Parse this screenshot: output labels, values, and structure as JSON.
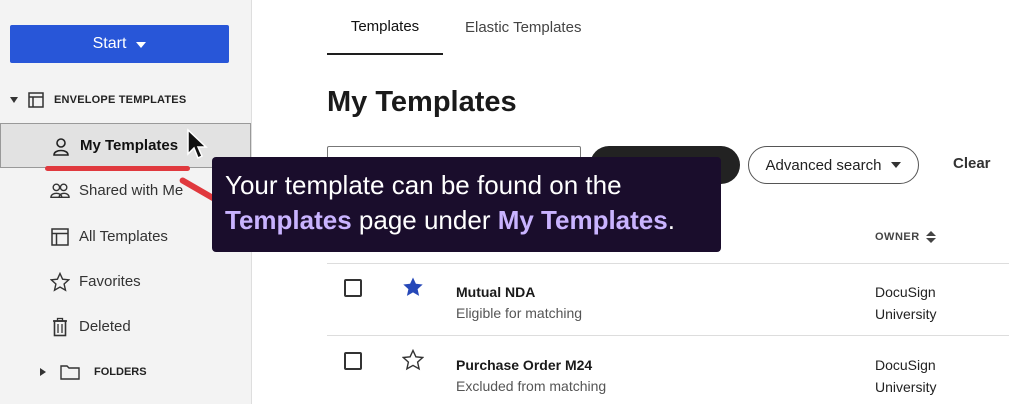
{
  "sidebar": {
    "start_label": "Start",
    "section_title": "ENVELOPE TEMPLATES",
    "items": [
      {
        "label": "My Templates",
        "icon": "person-icon"
      },
      {
        "label": "Shared with Me",
        "icon": "people-icon"
      },
      {
        "label": "All Templates",
        "icon": "template-icon"
      },
      {
        "label": "Favorites",
        "icon": "star-outline-icon"
      },
      {
        "label": "Deleted",
        "icon": "trash-icon"
      }
    ],
    "folders_label": "FOLDERS"
  },
  "tabs": [
    {
      "label": "Templates",
      "active": true
    },
    {
      "label": "Elastic Templates",
      "active": false
    }
  ],
  "page_title": "My Templates",
  "toolbar": {
    "advanced_search_label": "Advanced search",
    "clear_label": "Clear"
  },
  "table": {
    "owner_header": "OWNER",
    "rows": [
      {
        "name": "Mutual NDA",
        "status": "Eligible for matching",
        "owner_line1": "DocuSign",
        "owner_line2": "University",
        "favorite": true
      },
      {
        "name": "Purchase Order M24",
        "status": "Excluded from matching",
        "owner_line1": "DocuSign",
        "owner_line2": "University",
        "favorite": false
      }
    ]
  },
  "tooltip": {
    "line1": "Your template can be found on the",
    "line2_highlight1": "Templates",
    "line2_mid": " page under ",
    "line2_highlight2": "My Templates",
    "line2_end": "."
  },
  "colors": {
    "primary_button": "#2856d8",
    "tooltip_bg": "#1a0d2c",
    "tooltip_highlight": "#c9b3ff",
    "annotation_red": "#e0393e",
    "favorite_star": "#2648b8"
  }
}
